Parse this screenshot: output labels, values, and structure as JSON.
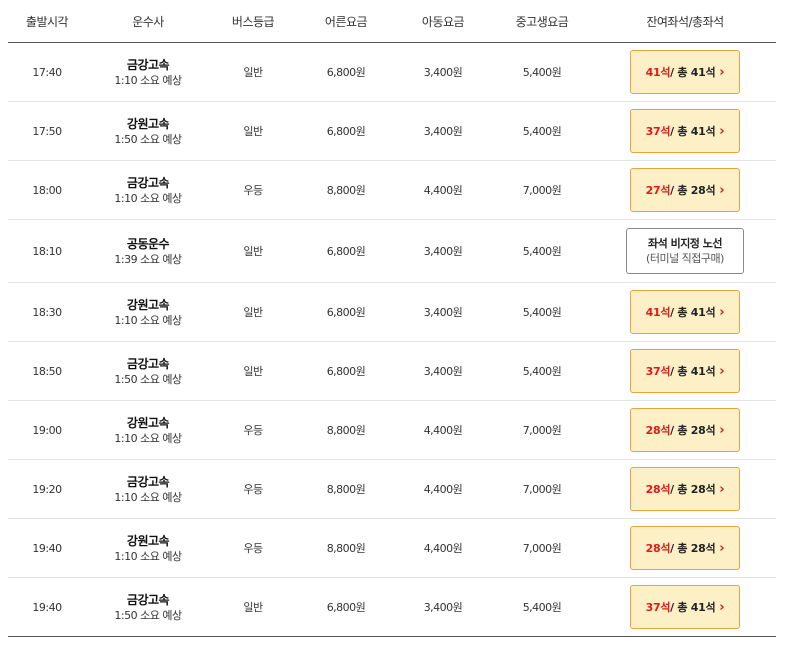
{
  "header": {
    "time": "출발시각",
    "company": "운수사",
    "grade": "버스등급",
    "adult": "어른요금",
    "child": "아동요금",
    "student": "중고생요금",
    "seats": "잔여좌석/총좌석"
  },
  "rows": [
    {
      "time": "17:40",
      "company": "금강고속",
      "duration": "1:10 소요 예상",
      "grade": "일반",
      "adult": "6,800원",
      "child": "3,400원",
      "student": "5,400원",
      "remain": "41석",
      "total": " / 총 41석"
    },
    {
      "time": "17:50",
      "company": "강원고속",
      "duration": "1:50 소요 예상",
      "grade": "일반",
      "adult": "6,800원",
      "child": "3,400원",
      "student": "5,400원",
      "remain": "37석",
      "total": " / 총 41석"
    },
    {
      "time": "18:00",
      "company": "금강고속",
      "duration": "1:10 소요 예상",
      "grade": "우등",
      "adult": "8,800원",
      "child": "4,400원",
      "student": "7,000원",
      "remain": "27석",
      "total": " / 총 28석"
    },
    {
      "time": "18:10",
      "company": "공동운수",
      "duration": "1:39 소요 예상",
      "grade": "일반",
      "adult": "6,800원",
      "child": "3,400원",
      "student": "5,400원",
      "info_line1": "좌석 비지정 노선",
      "info_line2": "(터미널 직접구매)"
    },
    {
      "time": "18:30",
      "company": "강원고속",
      "duration": "1:10 소요 예상",
      "grade": "일반",
      "adult": "6,800원",
      "child": "3,400원",
      "student": "5,400원",
      "remain": "41석",
      "total": " / 총 41석"
    },
    {
      "time": "18:50",
      "company": "금강고속",
      "duration": "1:50 소요 예상",
      "grade": "일반",
      "adult": "6,800원",
      "child": "3,400원",
      "student": "5,400원",
      "remain": "37석",
      "total": " / 총 41석"
    },
    {
      "time": "19:00",
      "company": "강원고속",
      "duration": "1:10 소요 예상",
      "grade": "우등",
      "adult": "8,800원",
      "child": "4,400원",
      "student": "7,000원",
      "remain": "28석",
      "total": " / 총 28석"
    },
    {
      "time": "19:20",
      "company": "금강고속",
      "duration": "1:10 소요 예상",
      "grade": "우등",
      "adult": "8,800원",
      "child": "4,400원",
      "student": "7,000원",
      "remain": "28석",
      "total": " / 총 28석"
    },
    {
      "time": "19:40",
      "company": "강원고속",
      "duration": "1:10 소요 예상",
      "grade": "우등",
      "adult": "8,800원",
      "child": "4,400원",
      "student": "7,000원",
      "remain": "28석",
      "total": " / 총 28석"
    },
    {
      "time": "19:40",
      "company": "금강고속",
      "duration": "1:50 소요 예상",
      "grade": "일반",
      "adult": "6,800원",
      "child": "3,400원",
      "student": "5,400원",
      "remain": "37석",
      "total": " / 총 41석"
    }
  ],
  "icons": {
    "select_arrow": "chevron-right-icon"
  },
  "colors": {
    "button_bg": "#fdf0c6",
    "button_border": "#e8a33b",
    "remain_text": "#e0191b",
    "chevron": "#d31a1a"
  }
}
